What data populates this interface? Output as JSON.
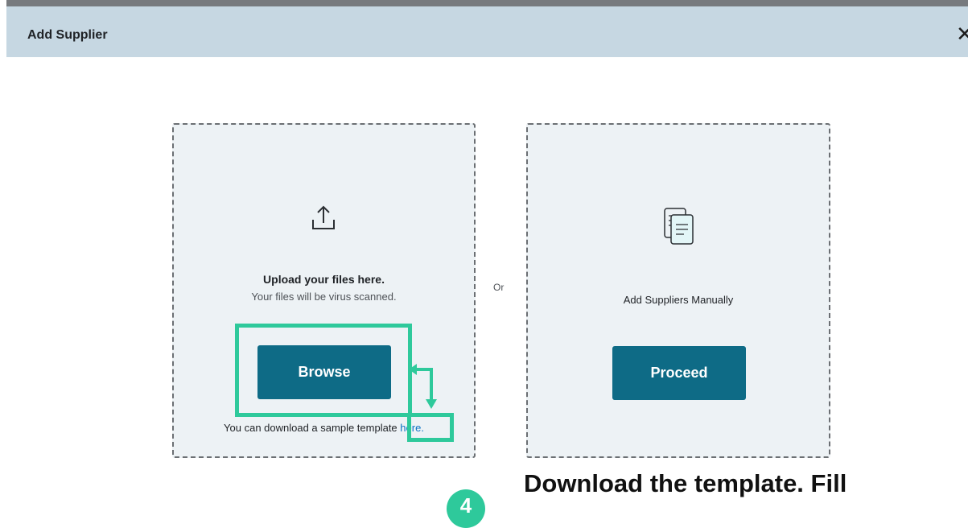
{
  "dialog": {
    "title": "Add Supplier",
    "close_icon": "close-icon",
    "close_glyph": "✕"
  },
  "upload_panel": {
    "icon": "upload-icon",
    "title": "Upload your files here.",
    "subtitle": "Your files will be virus scanned.",
    "browse_label": "Browse",
    "template_text": "You can download a sample template",
    "template_link": "here."
  },
  "separator": {
    "label": "Or"
  },
  "manual_panel": {
    "icon": "document-icon",
    "label": "Add Suppliers Manually",
    "proceed_label": "Proceed"
  },
  "annotation": {
    "step_number": "4",
    "caption": "Download the template. Fill",
    "highlight_color": "#2ec99b"
  },
  "colors": {
    "header_bg": "#c6d7e2",
    "panel_bg": "#edf2f5",
    "button_bg": "#0e6b86",
    "link": "#0a72c4"
  }
}
